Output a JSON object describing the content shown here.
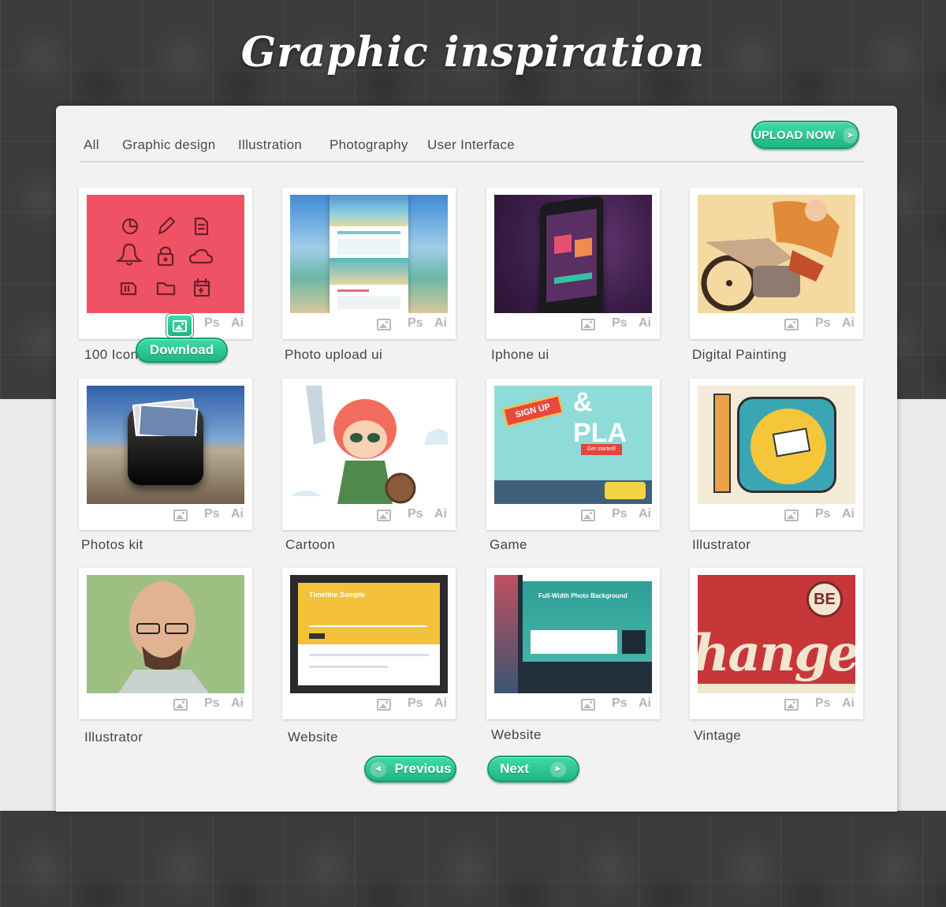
{
  "header": {
    "title": "Graphic inspiration"
  },
  "nav": {
    "items": [
      {
        "label": "All"
      },
      {
        "label": "Graphic design"
      },
      {
        "label": "Illustration"
      },
      {
        "label": "Photography"
      },
      {
        "label": "User Interface"
      }
    ]
  },
  "upload_button": {
    "label": "UPLOAD NOW"
  },
  "tool_labels": {
    "ps": "Ps",
    "ai": "Ai"
  },
  "items": [
    {
      "title": "100 Icon",
      "thumb": "icon-grid",
      "download_label": "Download"
    },
    {
      "title": "Photo upload ui",
      "thumb": "beach-website"
    },
    {
      "title": "Iphone ui",
      "thumb": "iphone"
    },
    {
      "title": "Digital Painting",
      "thumb": "motorbike"
    },
    {
      "title": "Photos kit",
      "thumb": "photo-box"
    },
    {
      "title": "Cartoon",
      "thumb": "girl-warrior"
    },
    {
      "title": "Game",
      "thumb": "game-site"
    },
    {
      "title": "Illustrator",
      "thumb": "window-poster"
    },
    {
      "title": "Illustrator",
      "thumb": "portrait"
    },
    {
      "title": "Website",
      "thumb": "timeline"
    },
    {
      "title": "Website",
      "thumb": "photo-bg-site"
    },
    {
      "title": "Vintage",
      "thumb": "change-poster"
    }
  ],
  "thumb_text": {
    "play": "& PLA",
    "sign_up": "SIGN UP",
    "get_started": "Get started!",
    "timeline": "Timeline Sample",
    "fullwidth": "Full-Width Photo Background",
    "be": "BE",
    "change": "hange"
  },
  "pagination": {
    "previous": "Previous",
    "next": "Next"
  },
  "colors": {
    "accent": "#25c48f",
    "panel": "#f2f2f2",
    "background_dark": "#3c3c3c"
  }
}
